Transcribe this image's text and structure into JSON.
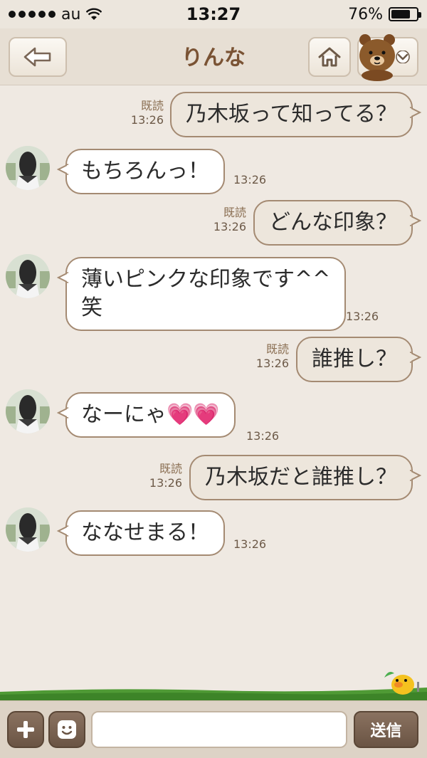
{
  "status_bar": {
    "carrier": "au",
    "time": "13:27",
    "battery": "76%",
    "battery_level": 0.76
  },
  "header": {
    "title": "りんな"
  },
  "messages": [
    {
      "side": "out",
      "text": "乃木坂って知ってる？",
      "read": "既読",
      "time": "13:26"
    },
    {
      "side": "in",
      "text": "もちろんっ！",
      "time": "13:26"
    },
    {
      "side": "out",
      "text": "どんな印象？",
      "read": "既読",
      "time": "13:26"
    },
    {
      "side": "in",
      "text_line1": "薄いピンクな印象です^^",
      "text_line2": "笑",
      "time": "13:26"
    },
    {
      "side": "out",
      "text": "誰推し？",
      "read": "既読",
      "time": "13:26"
    },
    {
      "side": "in",
      "text": "なーにゃ💗💗",
      "time": "13:26"
    },
    {
      "side": "out",
      "text": "乃木坂だと誰推し？",
      "read": "既読",
      "time": "13:26"
    },
    {
      "side": "in",
      "text": "ななせまる！",
      "time": "13:26"
    }
  ],
  "input_bar": {
    "placeholder": "",
    "send_label": "送信"
  },
  "colors": {
    "title": "#7a5334",
    "bubble_border": "#a48a72",
    "background": "#efe9e2",
    "button": "#6a5444"
  },
  "icons": [
    "back-arrow-icon",
    "home-icon",
    "brown-bear-icon",
    "chevron-down-icon",
    "plus-icon",
    "smiley-icon",
    "chick-icon"
  ]
}
